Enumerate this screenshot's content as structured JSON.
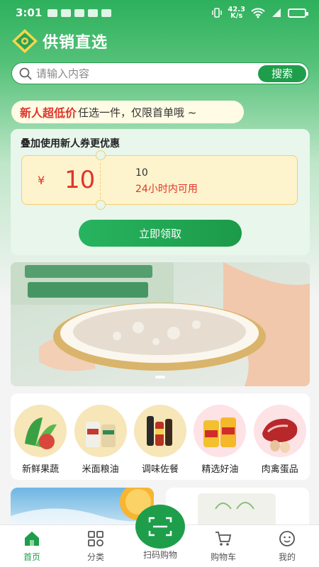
{
  "status_bar": {
    "time": "3:01",
    "network_speed_value": "42.3",
    "network_speed_unit": "K/s"
  },
  "header": {
    "brand_name": "供销直选"
  },
  "search": {
    "placeholder": "请输入内容",
    "button_label": "搜索"
  },
  "promo": {
    "highlight": "新人超低价",
    "text": "任选一件，仅限首单哦 ~"
  },
  "coupon_card": {
    "title": "叠加使用新人券更优惠",
    "currency": "¥",
    "amount": "10",
    "condition": "10",
    "validity": "24小时内可用",
    "claim_button": "立即领取"
  },
  "categories": [
    {
      "label": "新鲜果蔬",
      "icon": "vegetables-image"
    },
    {
      "label": "米面粮油",
      "icon": "rice-flour-image"
    },
    {
      "label": "调味佐餐",
      "icon": "seasoning-image"
    },
    {
      "label": "精选好油",
      "icon": "cooking-oil-image"
    },
    {
      "label": "肉禽蛋品",
      "icon": "meat-eggs-image"
    }
  ],
  "tabbar": {
    "home": "首页",
    "category": "分类",
    "scan": "扫码购物",
    "cart": "购物车",
    "mine": "我的"
  },
  "colors": {
    "brand_green": "#1e9e4b",
    "price_red": "#e0352b",
    "coupon_yellow": "#fdf3cd"
  }
}
